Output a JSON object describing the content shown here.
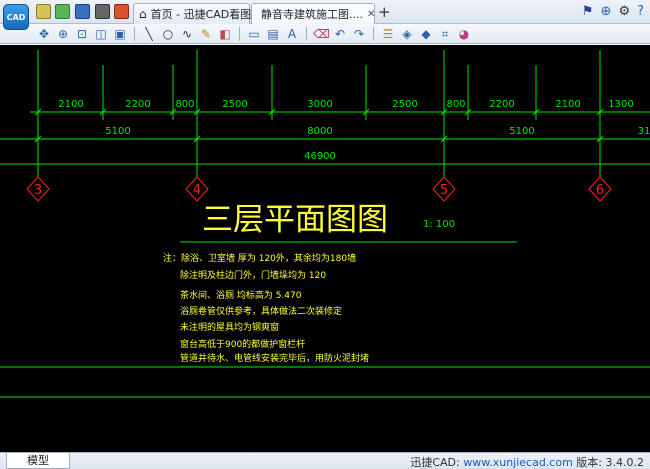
{
  "titlebar": {
    "logo_text": "CAD",
    "tabs": [
      {
        "label": "首页 - 迅捷CAD看图"
      },
      {
        "label": "静音寺建筑施工图...."
      }
    ],
    "tab_close_glyph": "✕",
    "add_tab_glyph": "+"
  },
  "icons": {
    "home": "home-icon",
    "drawing": "drawing-file-icon",
    "flag": "flag-icon",
    "zoom": "zoom-icon",
    "settings": "gear-icon",
    "help": "help-icon"
  },
  "drawing": {
    "dims_row1": [
      "2100",
      "2200",
      "800",
      "2500",
      "3000",
      "2500",
      "800",
      "2200",
      "2100",
      "1300"
    ],
    "dims_row2": [
      "5100",
      "8000",
      "5100",
      "31"
    ],
    "total_dim": "46900",
    "axis_labels": [
      "3",
      "4",
      "5",
      "6"
    ],
    "plan_title": "三层平面图图",
    "scale": "1: 100",
    "notes": [
      "注：除浴、卫室墙  厚为 120外，其余均为180墙",
      "除注明及柱边门外，门墙垛均为  120",
      "茶水间、浴厕  均标高为 5.470",
      "浴厕卷管仅供参考，具体做法二次装修定",
      "未注明的屋具均为钢爽窗",
      "窗台高低于900的都做护窗栏杆",
      "管道井待水、电管线安装完毕后，用防火泥封堵"
    ],
    "colors": {
      "background": "#000000",
      "green": "#00e600",
      "yellow": "#ffff33",
      "red": "#ff2020"
    }
  },
  "statusbar": {
    "model_tab": "模型",
    "app_name": "迅捷CAD: ",
    "website": "www.xunjiecad.com",
    "version": " 版本: 3.4.0.2"
  }
}
